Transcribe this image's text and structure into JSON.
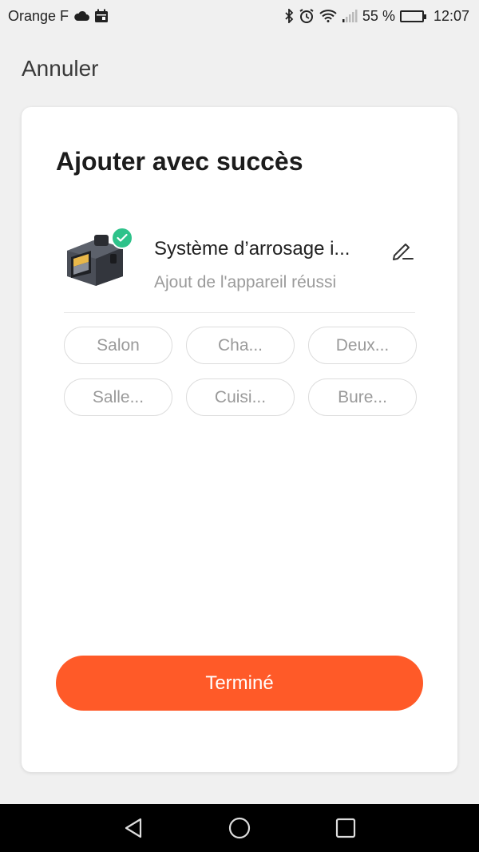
{
  "status_bar": {
    "carrier": "Orange F",
    "battery_percent": "55 %",
    "battery_level": 0.55,
    "time": "12:07",
    "icons": [
      "cloud-icon",
      "calendar-icon",
      "bluetooth-icon",
      "alarm-icon",
      "wifi-icon",
      "signal-icon",
      "battery-icon"
    ]
  },
  "header": {
    "cancel_label": "Annuler"
  },
  "card": {
    "title": "Ajouter avec succès",
    "device": {
      "name": "Système d’arrosage i...",
      "status": "Ajout de l'appareil réussi",
      "icons": [
        "device-image",
        "check-badge-icon",
        "edit-icon"
      ]
    },
    "rooms": [
      "Salon",
      "Cha...",
      "Deux...",
      "Salle...",
      "Cuisi...",
      "Bure..."
    ],
    "done_label": "Terminé"
  },
  "colors": {
    "accent": "#ff5a28",
    "success": "#2ec28a",
    "background": "#f0f0f0"
  },
  "nav_bar": {
    "icons": [
      "back-icon",
      "home-icon",
      "recents-icon"
    ]
  }
}
